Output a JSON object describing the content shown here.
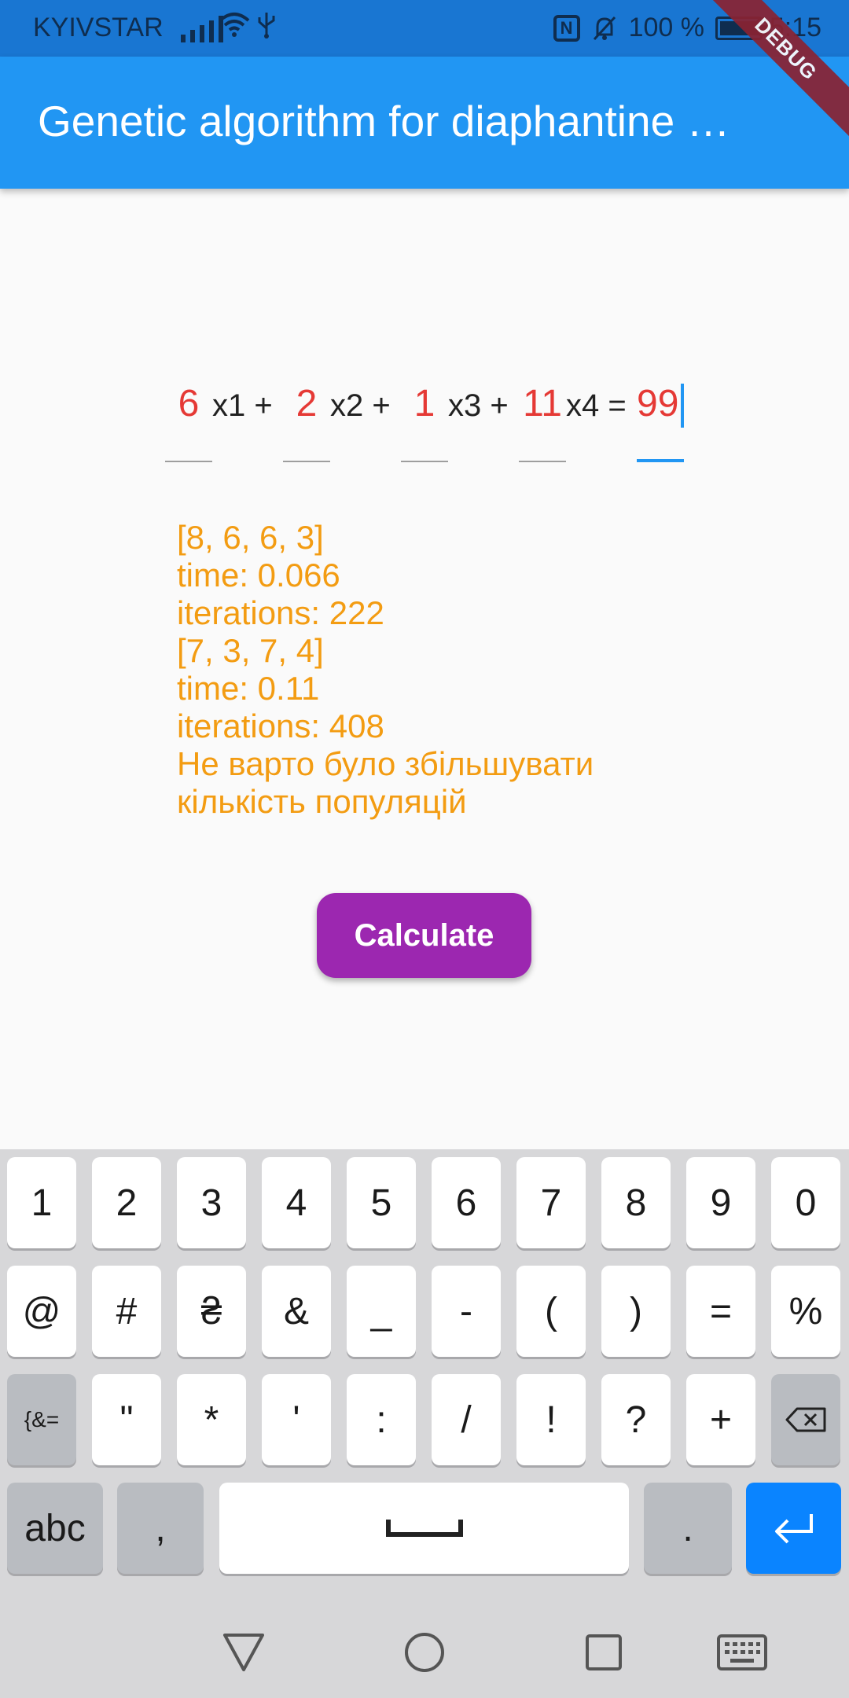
{
  "status_bar": {
    "carrier": "KYIVSTAR",
    "battery_percent": "100 %",
    "battery_level": 1.0,
    "time": "05:15"
  },
  "app_bar": {
    "title": "Genetic algorithm for diaphantine …",
    "background": "#2196f3"
  },
  "debug_banner": "DEBUG",
  "equation": {
    "coefficients": [
      "6",
      "2",
      "1",
      "11"
    ],
    "variables": [
      "x1 +",
      "x2 +",
      "x3 +",
      "x4 ="
    ],
    "result": "99",
    "value_color": "#e53935"
  },
  "results": {
    "lines": [
      "[8, 6, 6, 3]",
      "time: 0.066",
      "iterations: 222",
      "[7, 3, 7, 4]",
      "time: 0.11",
      "iterations: 408",
      "Не варто було збільшувати",
      "кількість популяцій"
    ],
    "color": "#f39c12"
  },
  "calculate_button": {
    "label": "Calculate",
    "color": "#9c27b0"
  },
  "keyboard": {
    "row1": [
      "1",
      "2",
      "3",
      "4",
      "5",
      "6",
      "7",
      "8",
      "9",
      "0"
    ],
    "row2": [
      "@",
      "#",
      "₴",
      "&",
      "_",
      "-",
      "(",
      ")",
      "=",
      "%"
    ],
    "row3": [
      "{&=",
      "\"",
      "*",
      "'",
      ":",
      "/",
      "!",
      "?",
      "+"
    ],
    "row4": {
      "abc": "abc",
      "comma": ",",
      "period": "."
    },
    "icons": [
      "backspace-icon",
      "space-icon",
      "enter-icon"
    ]
  },
  "nav_bar": {
    "icons": [
      "back-triangle-icon",
      "home-circle-icon",
      "recents-square-icon",
      "keyboard-icon"
    ]
  }
}
